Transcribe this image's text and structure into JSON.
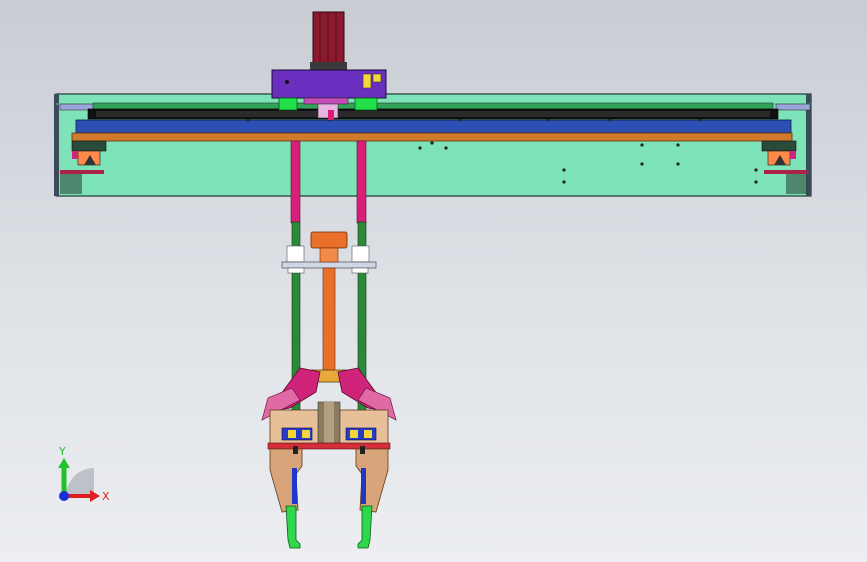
{
  "view": {
    "background_top": "#c9ccd3",
    "background_bottom": "#eceef1"
  },
  "triad": {
    "y_label": "Y",
    "x_label": "X",
    "y_color": "#22c02a",
    "x_color": "#e02020",
    "z_color": "#1a2fd6"
  },
  "colors": {
    "frame": "#7ee3b9",
    "rail_blue": "#2c4fb3",
    "rail_orange": "#d27a2c",
    "motor": "#8b1a2e",
    "motor_mount": "#6a2fbf",
    "bracket_green": "#22e04a",
    "rod_pink": "#d81e78",
    "rod_green": "#2a8a3a",
    "cylinder": "#e8702a",
    "gripper_body": "#d9a47a",
    "gripper_pink": "#d0247a",
    "gripper_finger_green": "#2fd84a",
    "gripper_blue": "#2036c8"
  }
}
